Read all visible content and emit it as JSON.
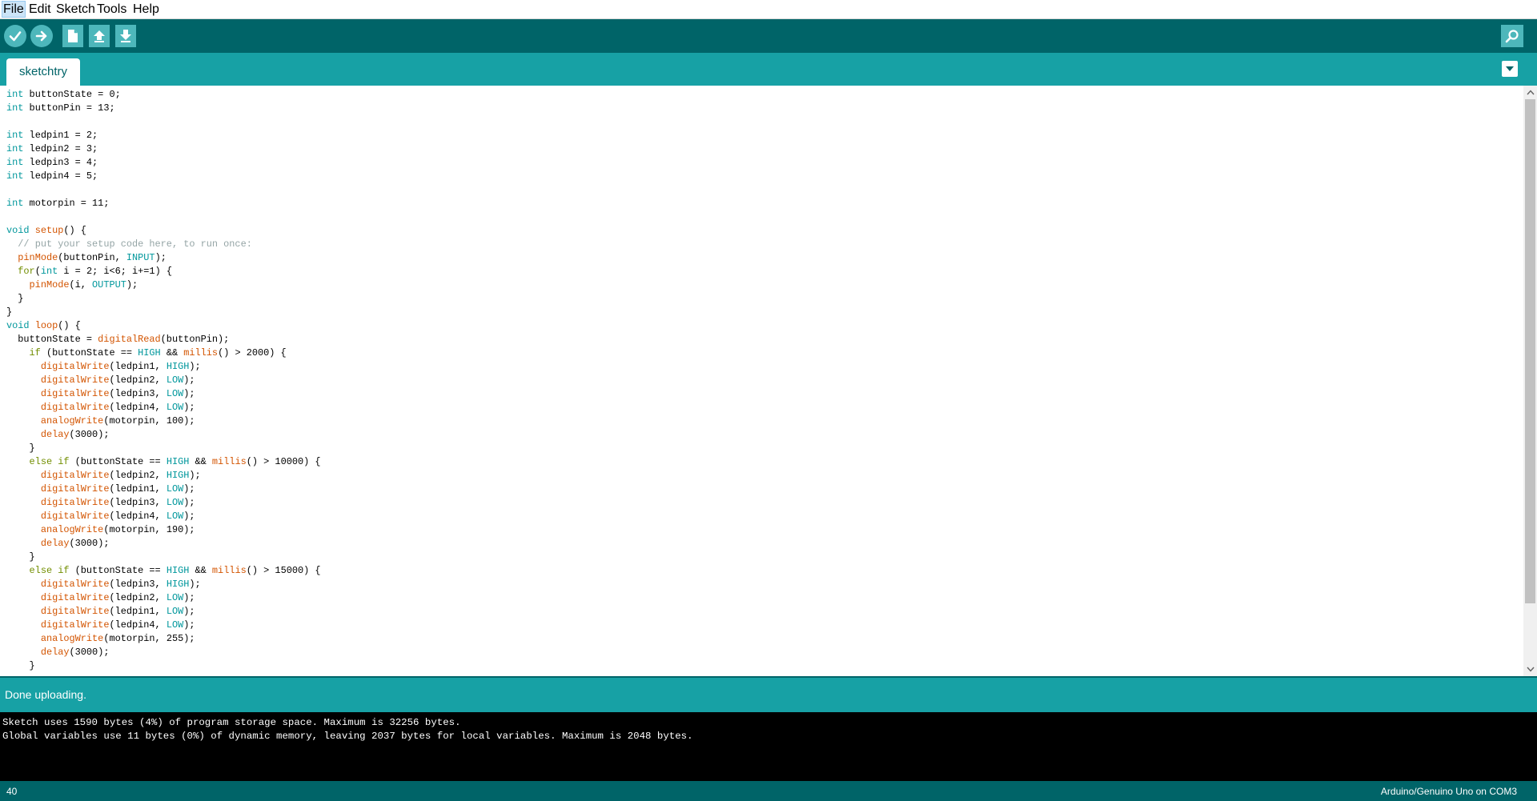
{
  "menubar": {
    "items": [
      {
        "label": "File"
      },
      {
        "label": "Edit"
      },
      {
        "label": "Sketch"
      },
      {
        "label": "Tools"
      },
      {
        "label": "Help"
      }
    ]
  },
  "toolbar": {
    "buttons": [
      {
        "name": "verify",
        "icon": "check-icon"
      },
      {
        "name": "upload",
        "icon": "arrow-right-icon"
      },
      {
        "name": "new",
        "icon": "new-file-icon"
      },
      {
        "name": "open",
        "icon": "arrow-up-icon"
      },
      {
        "name": "save",
        "icon": "arrow-down-icon"
      },
      {
        "name": "serial-monitor",
        "icon": "magnifier-icon"
      }
    ]
  },
  "tabs": [
    {
      "label": "sketchtry",
      "active": true
    }
  ],
  "editor": {
    "code_lines": [
      "int buttonState = 0;",
      "int buttonPin = 13;",
      "",
      "int ledpin1 = 2;",
      "int ledpin2 = 3;",
      "int ledpin3 = 4;",
      "int ledpin4 = 5;",
      "",
      "int motorpin = 11;",
      "",
      "void setup() {",
      "  // put your setup code here, to run once:",
      "  pinMode(buttonPin, INPUT);",
      "  for(int i = 2; i<6; i+=1) {",
      "    pinMode(i, OUTPUT);",
      "  }",
      "}",
      "void loop() {",
      "  buttonState = digitalRead(buttonPin);",
      "    if (buttonState == HIGH && millis() > 2000) {",
      "      digitalWrite(ledpin1, HIGH);",
      "      digitalWrite(ledpin2, LOW);",
      "      digitalWrite(ledpin3, LOW);",
      "      digitalWrite(ledpin4, LOW);",
      "      analogWrite(motorpin, 100);",
      "      delay(3000);",
      "    }",
      "    else if (buttonState == HIGH && millis() > 10000) {",
      "      digitalWrite(ledpin2, HIGH);",
      "      digitalWrite(ledpin1, LOW);",
      "      digitalWrite(ledpin3, LOW);",
      "      digitalWrite(ledpin4, LOW);",
      "      analogWrite(motorpin, 190);",
      "      delay(3000);",
      "    }",
      "    else if (buttonState == HIGH && millis() > 15000) {",
      "      digitalWrite(ledpin3, HIGH);",
      "      digitalWrite(ledpin2, LOW);",
      "      digitalWrite(ledpin1, LOW);",
      "      digitalWrite(ledpin4, LOW);",
      "      analogWrite(motorpin, 255);",
      "      delay(3000);",
      "    }"
    ]
  },
  "status": {
    "message": "Done uploading."
  },
  "console": {
    "lines": [
      "Sketch uses 1590 bytes (4%) of program storage space. Maximum is 32256 bytes.",
      "Global variables use 11 bytes (0%) of dynamic memory, leaving 2037 bytes for local variables. Maximum is 2048 bytes."
    ]
  },
  "footer": {
    "line_number": "40",
    "board": "Arduino/Genuino Uno on COM3"
  },
  "colors": {
    "toolbar": "#006468",
    "tabbar": "#17a1a5",
    "button": "#4db7bb",
    "keyword_type": "#00979c",
    "keyword_control": "#728e00",
    "function": "#d35400",
    "comment": "#95a5a6"
  }
}
